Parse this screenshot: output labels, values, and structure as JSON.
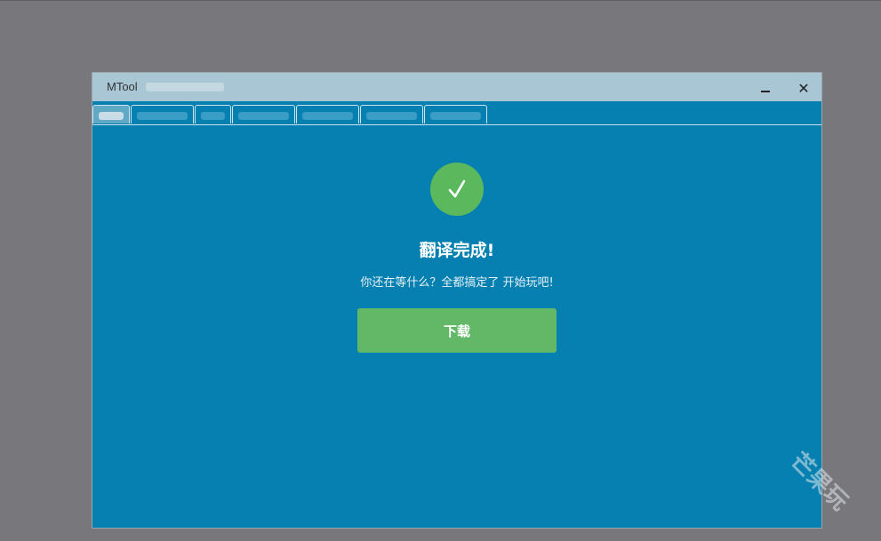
{
  "window": {
    "title": "MTool",
    "minimize_label": "–",
    "close_label": "✕"
  },
  "tabs": [
    {
      "label": "",
      "active": true
    },
    {
      "label": "",
      "active": false
    },
    {
      "label": "",
      "active": false
    },
    {
      "label": "",
      "active": false
    },
    {
      "label": "",
      "active": false
    },
    {
      "label": "",
      "active": false
    },
    {
      "label": "",
      "active": false
    }
  ],
  "main": {
    "icon": "check-circle-icon",
    "heading": "翻译完成!",
    "subtitle": "你还在等什么？全都搞定了 开始玩吧!",
    "download_label": "下载"
  },
  "watermark": "芒果玩",
  "colors": {
    "accent": "#0680b0",
    "success": "#5cb85c",
    "button": "#62b866",
    "titlebar": "#a9c6d5",
    "backdrop": "#78777b"
  }
}
